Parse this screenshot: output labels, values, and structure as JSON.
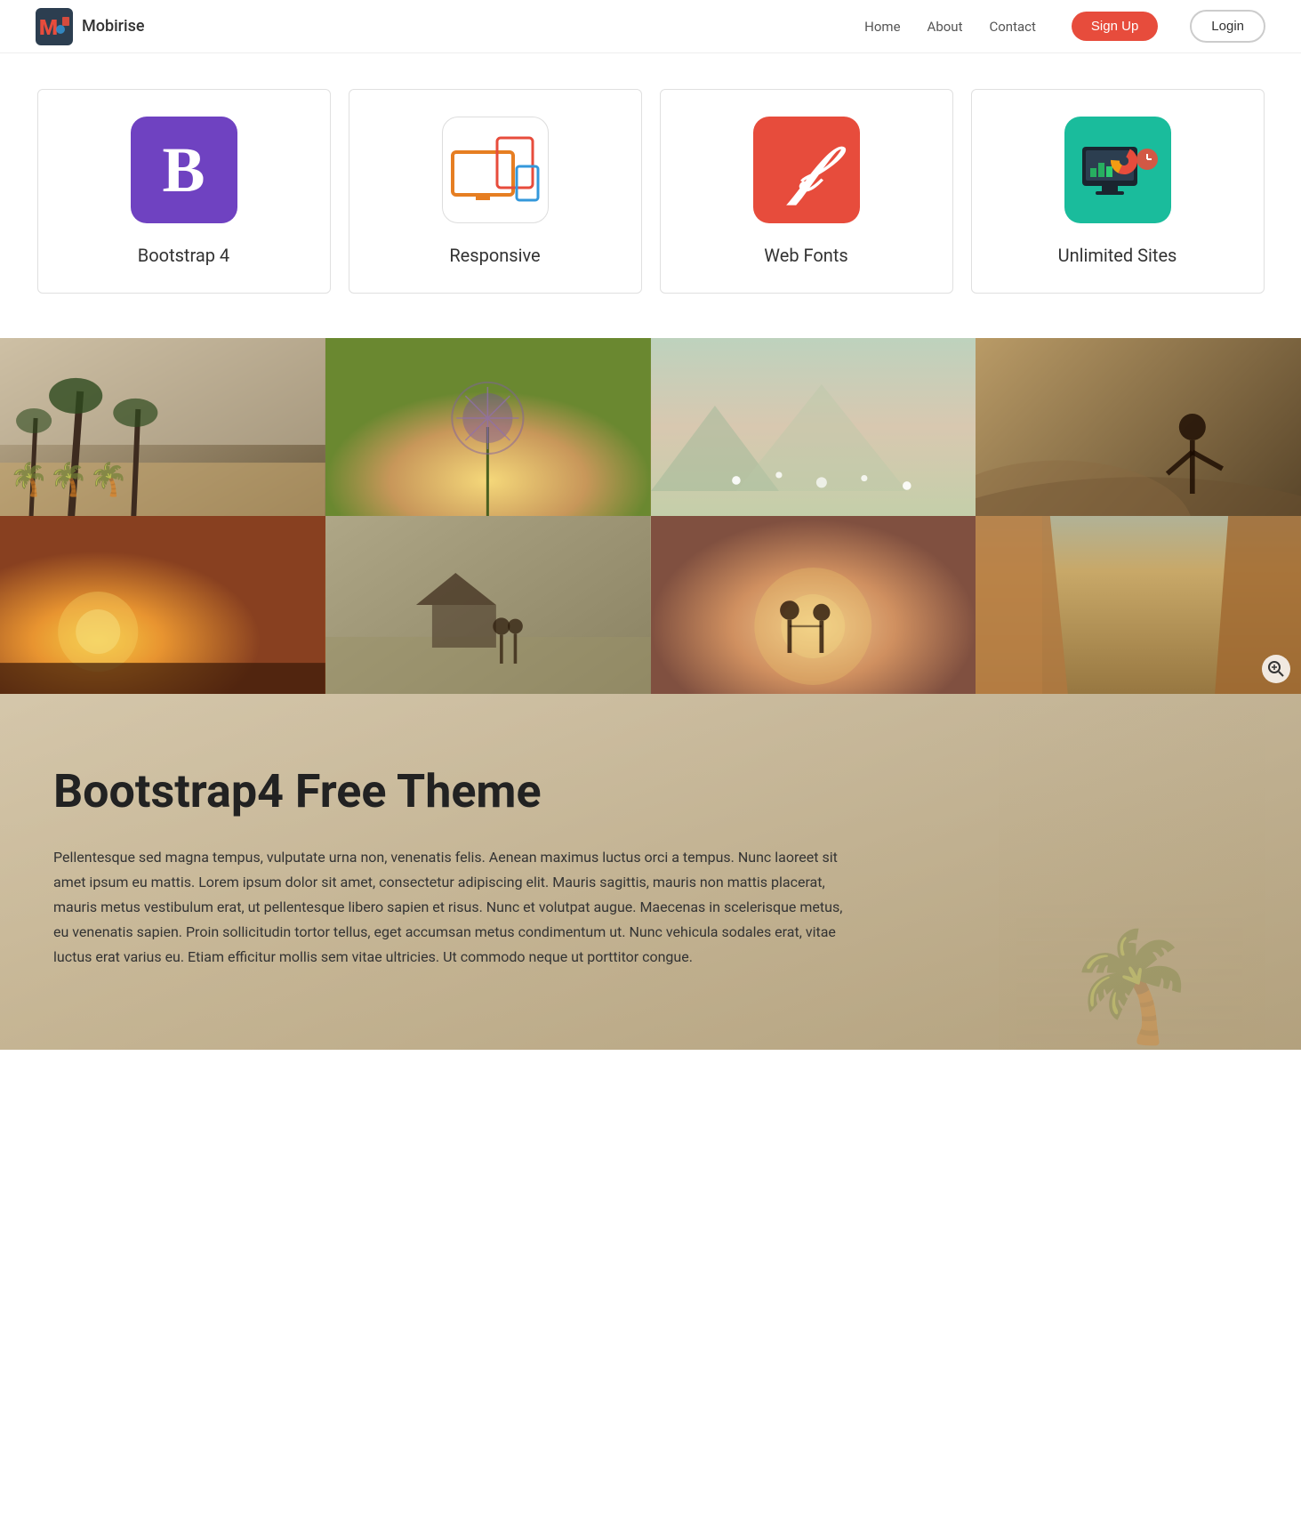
{
  "nav": {
    "logo_text": "Mobirise",
    "links": [
      {
        "label": "Home",
        "key": "home"
      },
      {
        "label": "About",
        "key": "about"
      },
      {
        "label": "Contact",
        "key": "contact"
      }
    ],
    "signup_label": "Sign Up",
    "login_label": "Login"
  },
  "features": {
    "items": [
      {
        "key": "bootstrap",
        "icon_type": "bootstrap",
        "label": "Bootstrap 4"
      },
      {
        "key": "responsive",
        "icon_type": "responsive",
        "label": "Responsive"
      },
      {
        "key": "webfonts",
        "icon_type": "webfonts",
        "label": "Web Fonts"
      },
      {
        "key": "unlimited",
        "icon_type": "unlimited",
        "label": "Unlimited Sites"
      }
    ]
  },
  "gallery": {
    "zoom_icon": "⊕",
    "cells": [
      {
        "key": "cell-1",
        "alt": "Palm trees on beach"
      },
      {
        "key": "cell-2",
        "alt": "Purple flower in sunlight"
      },
      {
        "key": "cell-3",
        "alt": "Wildflowers in field"
      },
      {
        "key": "cell-4",
        "alt": "Person on hillside sunset"
      },
      {
        "key": "cell-5",
        "alt": "Golden sunset landscape"
      },
      {
        "key": "cell-6",
        "alt": "Wedding couple in field"
      },
      {
        "key": "cell-7",
        "alt": "Couple in sunset"
      },
      {
        "key": "cell-8",
        "alt": "Rocky canyon landscape"
      }
    ]
  },
  "content": {
    "heading": "Bootstrap4 Free Theme",
    "body": "Pellentesque sed magna tempus, vulputate urna non, venenatis felis. Aenean maximus luctus orci a tempus. Nunc laoreet sit amet ipsum eu mattis. Lorem ipsum dolor sit amet, consectetur adipiscing elit. Mauris sagittis, mauris non mattis placerat, mauris metus vestibulum erat, ut pellentesque libero sapien et risus. Nunc et volutpat augue. Maecenas in scelerisque metus, eu venenatis sapien. Proin sollicitudin tortor tellus, eget accumsan metus condimentum ut. Nunc vehicula sodales erat, vitae luctus erat varius eu. Etiam efficitur mollis sem vitae ultricies. Ut commodo neque ut porttitor congue."
  }
}
